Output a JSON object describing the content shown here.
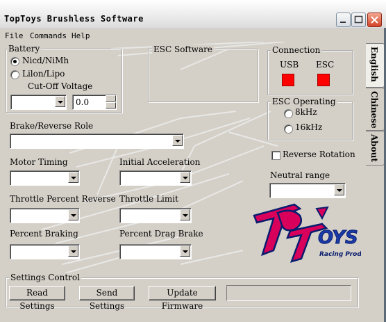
{
  "window": {
    "title": "TopToys Brushless Software"
  },
  "menu": [
    "File",
    "Commands",
    "Help"
  ],
  "battery": {
    "label": "Battery",
    "options": [
      "Nicd/NiMh",
      "Lilon/Lipo"
    ],
    "selected": "Nicd/NiMh",
    "cutoff_label": "Cut-Off Voltage",
    "cutoff_select_value": "",
    "cutoff_value": "0.0"
  },
  "esc_software": {
    "label": "ESC Software"
  },
  "connection": {
    "label": "Connection",
    "usb": "USB",
    "esc": "ESC",
    "status_color": "#ff0000"
  },
  "esc_operating": {
    "label": "ESC Operating",
    "options": [
      "8kHz",
      "16kHz"
    ]
  },
  "reverse_rotation": {
    "label": "Reverse Rotation",
    "checked": false
  },
  "neutral_range": {
    "label": "Neutral range",
    "value": ""
  },
  "brake_reverse": {
    "label": "Brake/Reverse Role",
    "value": ""
  },
  "motor_timing": {
    "label": "Motor Timing",
    "value": ""
  },
  "initial_acceleration": {
    "label": "Initial Acceleration",
    "value": ""
  },
  "throttle_percent_reverse": {
    "label": "Throttle Percent Reverse",
    "value": ""
  },
  "throttle_limit": {
    "label": "Throttle Limit",
    "value": ""
  },
  "percent_braking": {
    "label": "Percent Braking",
    "value": ""
  },
  "percent_drag_brake": {
    "label": "Percent Drag Brake",
    "value": ""
  },
  "settings_control": {
    "label": "Settings Control",
    "read": "Read Settings",
    "send": "Send Settings",
    "update": "Update Firmware"
  },
  "tabs": [
    "English",
    "Chinese",
    "About"
  ],
  "active_tab": "English",
  "logo": {
    "line1": "TOP TOYS",
    "line2": "Racing Products"
  },
  "icons": {
    "minimize": "minimize-icon",
    "maximize": "maximize-icon",
    "close": "close-icon"
  }
}
